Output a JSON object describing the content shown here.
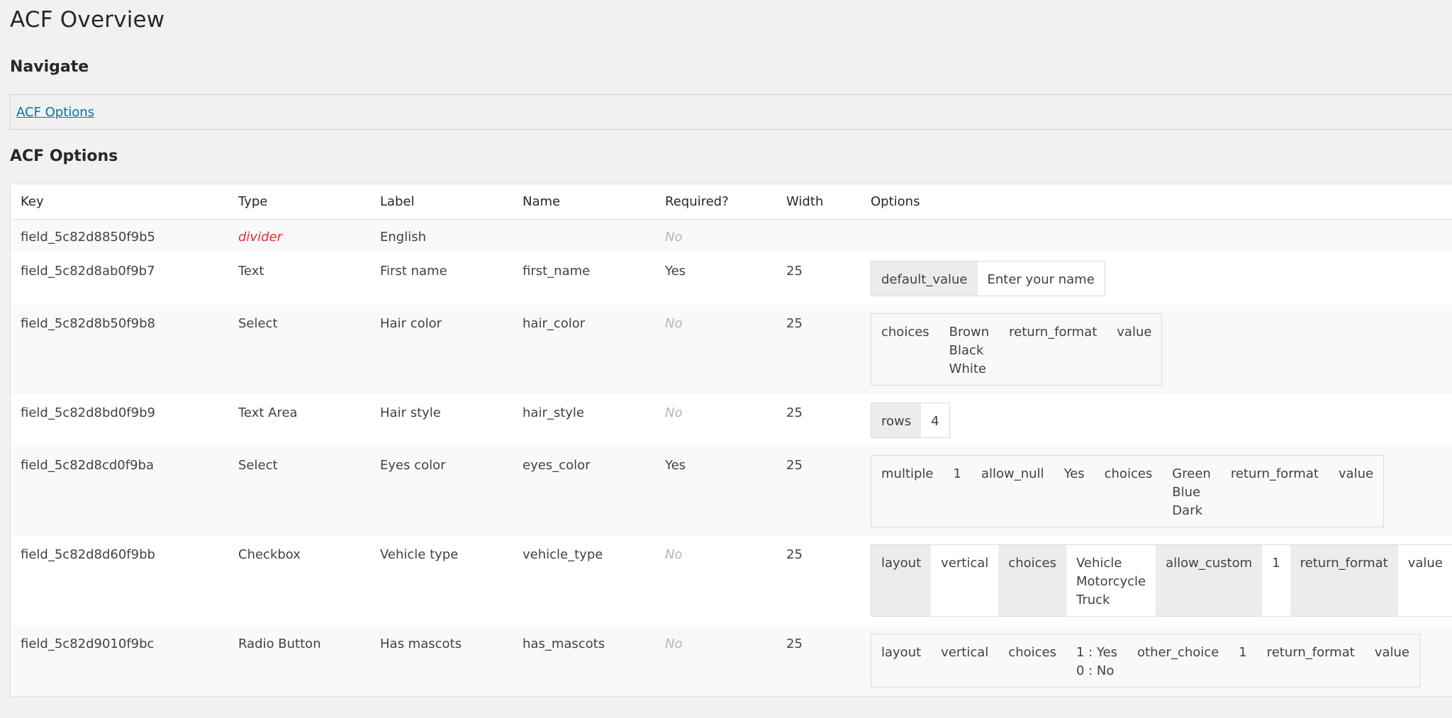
{
  "page": {
    "title": "ACF Overview",
    "navigate_heading": "Navigate",
    "nav_link": "ACF Options",
    "section_heading": "ACF Options"
  },
  "table": {
    "headers": {
      "key": "Key",
      "type": "Type",
      "label": "Label",
      "name": "Name",
      "required": "Required?",
      "width": "Width",
      "options": "Options"
    },
    "rows": [
      {
        "key": "field_5c82d8850f9b5",
        "type": "divider",
        "label": "English",
        "name": "",
        "required": "No",
        "width": "",
        "options": []
      },
      {
        "key": "field_5c82d8ab0f9b7",
        "type": "Text",
        "label": "First name",
        "name": "first_name",
        "required": "Yes",
        "width": "25",
        "options": [
          {
            "k": "default_value",
            "v": "Enter your name"
          }
        ]
      },
      {
        "key": "field_5c82d8b50f9b8",
        "type": "Select",
        "label": "Hair color",
        "name": "hair_color",
        "required": "No",
        "width": "25",
        "options": [
          {
            "k": "choices",
            "v": "Brown\nBlack\nWhite"
          },
          {
            "k": "return_format",
            "v": "value"
          }
        ]
      },
      {
        "key": "field_5c82d8bd0f9b9",
        "type": "Text Area",
        "label": "Hair style",
        "name": "hair_style",
        "required": "No",
        "width": "25",
        "options": [
          {
            "k": "rows",
            "v": "4"
          }
        ]
      },
      {
        "key": "field_5c82d8cd0f9ba",
        "type": "Select",
        "label": "Eyes color",
        "name": "eyes_color",
        "required": "Yes",
        "width": "25",
        "options": [
          {
            "k": "multiple",
            "v": "1"
          },
          {
            "k": "allow_null",
            "v": "Yes"
          },
          {
            "k": "choices",
            "v": "Green\nBlue\nDark"
          },
          {
            "k": "return_format",
            "v": "value"
          }
        ]
      },
      {
        "key": "field_5c82d8d60f9bb",
        "type": "Checkbox",
        "label": "Vehicle type",
        "name": "vehicle_type",
        "required": "No",
        "width": "25",
        "options": [
          {
            "k": "layout",
            "v": "vertical"
          },
          {
            "k": "choices",
            "v": "Vehicle\nMotorcycle\nTruck"
          },
          {
            "k": "allow_custom",
            "v": "1"
          },
          {
            "k": "return_format",
            "v": "value"
          }
        ]
      },
      {
        "key": "field_5c82d9010f9bc",
        "type": "Radio Button",
        "label": "Has mascots",
        "name": "has_mascots",
        "required": "No",
        "width": "25",
        "options": [
          {
            "k": "layout",
            "v": "vertical"
          },
          {
            "k": "choices",
            "v": "1 : Yes\n0 : No"
          },
          {
            "k": "other_choice",
            "v": "1"
          },
          {
            "k": "return_format",
            "v": "value"
          }
        ]
      }
    ]
  }
}
